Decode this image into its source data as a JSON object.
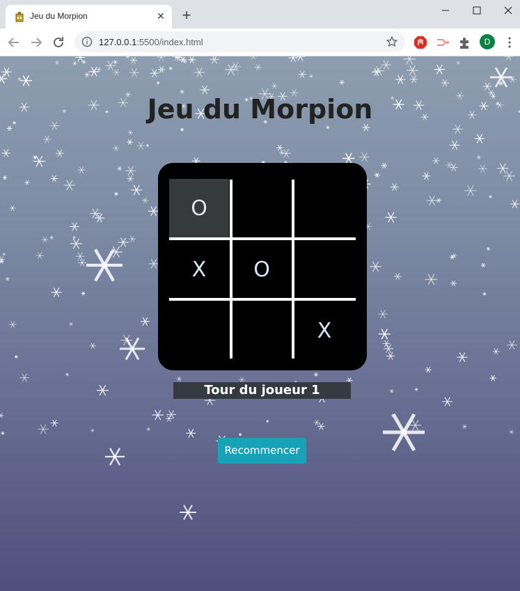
{
  "browser": {
    "tab_title": "Jeu du Morpion",
    "url_host": "127.0.0.1",
    "url_path": ":5500/index.html",
    "profile_initial": "D"
  },
  "page": {
    "title": "Jeu du Morpion",
    "status": "Tour du joueur 1",
    "restart_label": "Recommencer"
  },
  "board": {
    "cells": [
      "O",
      "",
      "",
      "X",
      "O",
      "",
      "",
      "",
      "X"
    ],
    "highlighted_cell": 0
  },
  "colors": {
    "button": "#17a2b8",
    "status_bg": "#343a40",
    "board_bg": "#000000"
  }
}
